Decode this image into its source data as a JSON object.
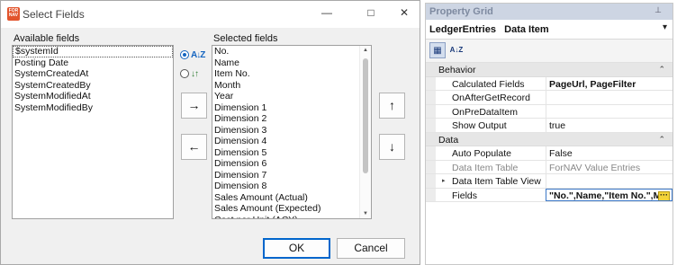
{
  "dialog": {
    "title": "Select Fields",
    "app_icon_text": "FOR NAV",
    "minimize_glyph": "—",
    "maximize_glyph": "□",
    "close_glyph": "✕",
    "available_label": "Available fields",
    "selected_label": "Selected fields",
    "available_fields": [
      "$systemId",
      "Posting Date",
      "SystemCreatedAt",
      "SystemCreatedBy",
      "SystemModifiedAt",
      "SystemModifiedBy"
    ],
    "selected_fields": [
      "No.",
      "Name",
      "Item No.",
      "Month",
      "Year",
      "Dimension 1",
      "Dimension 2",
      "Dimension 3",
      "Dimension 4",
      "Dimension 5",
      "Dimension 6",
      "Dimension 7",
      "Dimension 8",
      "Sales Amount (Actual)",
      "Sales Amount (Expected)",
      "Cost per Unit (ACY)"
    ],
    "sort_az_icon": "A↓Z",
    "sort_fields_icon": "↓↑",
    "add_arrow": "→",
    "remove_arrow": "←",
    "move_up_arrow": "↑",
    "move_down_arrow": "↓",
    "ok_label": "OK",
    "cancel_label": "Cancel"
  },
  "property_grid": {
    "title": "Property Grid",
    "pin_glyph": "⊥",
    "object_name": "LedgerEntries",
    "object_type": "Data Item",
    "dropdown_caret": "▾",
    "categorized_icon": "▦",
    "alphabetical_icon": "A↓Z",
    "categories": [
      {
        "name": "Behavior",
        "collapse_glyph": "⌃",
        "rows": [
          {
            "name": "Calculated Fields",
            "value": "PageUrl, PageFilter",
            "bold": true,
            "muted": false
          },
          {
            "name": "OnAfterGetRecord",
            "value": "",
            "bold": false,
            "muted": false
          },
          {
            "name": "OnPreDataItem",
            "value": "",
            "bold": false,
            "muted": false
          },
          {
            "name": "Show Output",
            "value": "true",
            "bold": false,
            "muted": false
          }
        ]
      },
      {
        "name": "Data",
        "collapse_glyph": "⌃",
        "rows": [
          {
            "name": "Auto Populate",
            "value": "False",
            "bold": false,
            "muted": false
          },
          {
            "name": "Data Item Table",
            "value": "ForNAV Value Entries",
            "bold": false,
            "muted": true
          },
          {
            "name": "Data Item Table View",
            "value": "",
            "bold": false,
            "muted": false,
            "expandable": true
          },
          {
            "name": "Fields",
            "value": "\"No.\",Name,\"Item No.\",M",
            "bold": true,
            "muted": false,
            "selected": true,
            "ellipsis": "···"
          }
        ]
      }
    ],
    "expand_glyph": "▸"
  },
  "colors": {
    "accent": "#0066cc",
    "pg_header": "#cdd5e3",
    "ellipsis_button": "#f3d33a",
    "app_icon": "#e2542c"
  }
}
